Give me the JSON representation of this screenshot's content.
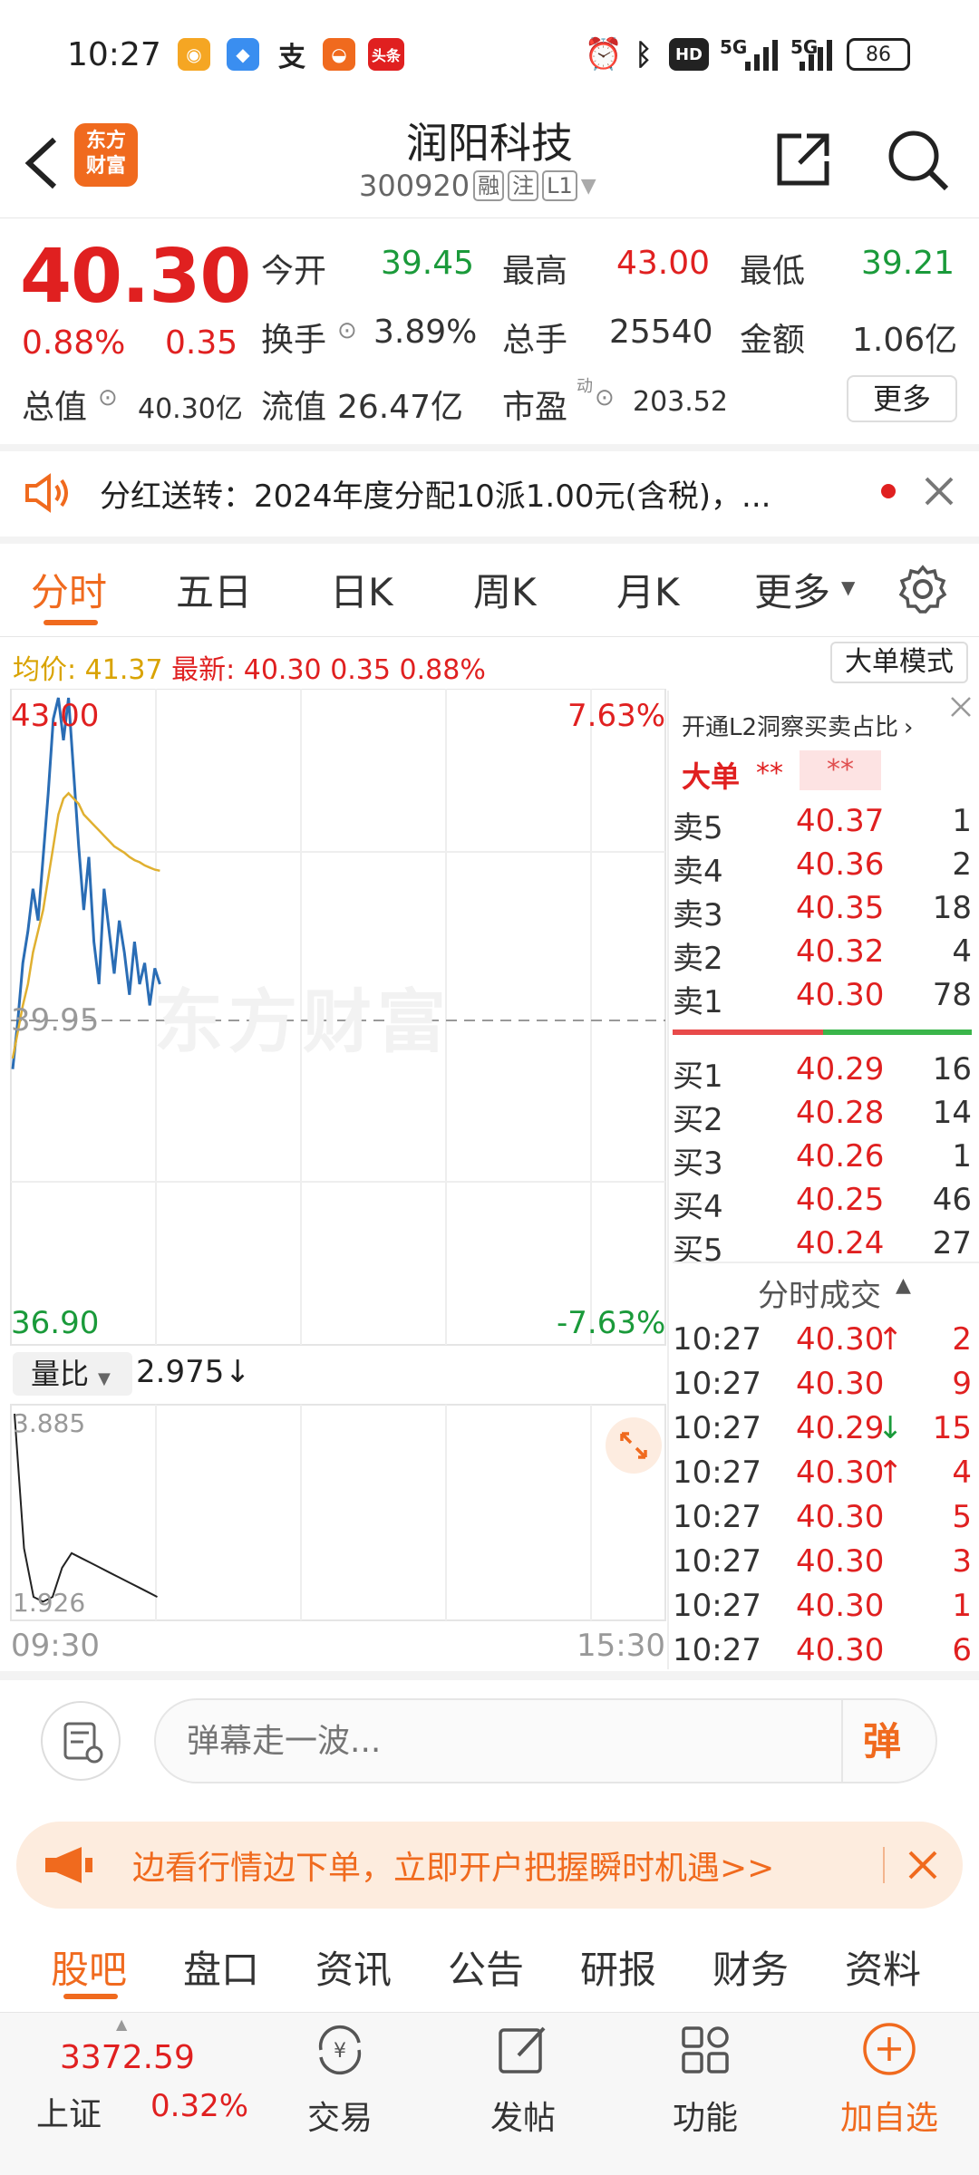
{
  "status_bar": {
    "time": "10:27",
    "battery": "86",
    "network_a": "5G",
    "network_b": "5G",
    "hd": "HD",
    "app_icon_toutiao": "头条"
  },
  "header": {
    "logo_line1": "东方",
    "logo_line2": "财富",
    "title": "润阳科技",
    "code": "300920",
    "tag_rong": "融",
    "tag_zhu": "注",
    "tag_l1": "L1"
  },
  "quote": {
    "price": "40.30",
    "change_pct": "0.88%",
    "change": "0.35",
    "open_label": "今开",
    "open": "39.45",
    "high_label": "最高",
    "high": "43.00",
    "low_label": "最低",
    "low": "39.21",
    "turnover_label": "换手",
    "turnover": "3.89%",
    "volume_label": "总手",
    "volume": "25540",
    "amount_label": "金额",
    "amount": "1.06亿",
    "mcap_label": "总值",
    "mcap": "40.30亿",
    "float_label": "流值",
    "float": "26.47亿",
    "pe_label": "市盈",
    "pe_sup": "动",
    "pe": "203.52",
    "more": "更多"
  },
  "dividend": {
    "text": "分红送转：2024年度分配10派1.00元(含税)，..."
  },
  "chart_tabs": [
    "分时",
    "五日",
    "日K",
    "周K",
    "月K",
    "更多"
  ],
  "chart_info": {
    "avg_label": "均价:",
    "avg": "41.37",
    "last_label": "最新:",
    "last": "40.30",
    "chg": "0.35",
    "pct": "0.88%",
    "mode": "大单模式"
  },
  "chart_labels": {
    "top_price": "43.00",
    "top_pct": "7.63%",
    "mid_price": "39.95",
    "bot_price": "36.90",
    "bot_pct": "-7.63%",
    "watermark": "东方财富",
    "time_start": "09:30",
    "time_end": "15:30"
  },
  "volume_ratio": {
    "label": "量比",
    "value": "2.975",
    "top": "3.885",
    "bottom": "1.926"
  },
  "chart_data": {
    "type": "line",
    "series": [
      {
        "name": "",
        "color": "#2a6db5",
        "values": [
          39.5,
          39.95,
          40.5,
          40.8,
          41.2,
          40.9,
          41.5,
          42.1,
          42.8,
          43.0,
          42.6,
          43.0,
          42.3,
          41.6,
          41.0,
          41.5,
          40.7,
          40.3,
          41.2,
          40.8,
          40.4,
          40.9,
          40.6,
          40.2,
          40.7,
          40.3,
          40.5,
          40.1,
          40.45,
          40.3
        ]
      },
      {
        "name": "",
        "color": "#e0b030",
        "values": [
          39.6,
          39.85,
          40.1,
          40.3,
          40.6,
          40.8,
          41.0,
          41.3,
          41.6,
          41.9,
          42.05,
          42.1,
          42.05,
          42.0,
          41.9,
          41.85,
          41.8,
          41.75,
          41.7,
          41.65,
          41.6,
          41.57,
          41.54,
          41.5,
          41.47,
          41.45,
          41.42,
          41.4,
          41.38,
          41.37
        ]
      }
    ],
    "ylim": [
      36.9,
      43.0
    ]
  },
  "volume_ratio_data": {
    "values": [
      3.885,
      2.5,
      2.0,
      1.95,
      2.0,
      2.3,
      2.45,
      2.4,
      2.35,
      2.3,
      2.25,
      2.2,
      2.15,
      2.1,
      2.05,
      2.0
    ],
    "ylim": [
      1.926,
      3.885
    ]
  },
  "orderbook": {
    "title": "开通L2洞察买卖占比",
    "big_label": "大单",
    "big_a": "**",
    "big_b": "**",
    "sells": [
      {
        "label": "卖5",
        "price": "40.37",
        "vol": "1"
      },
      {
        "label": "卖4",
        "price": "40.36",
        "vol": "2"
      },
      {
        "label": "卖3",
        "price": "40.35",
        "vol": "18"
      },
      {
        "label": "卖2",
        "price": "40.32",
        "vol": "4"
      },
      {
        "label": "卖1",
        "price": "40.30",
        "vol": "78"
      }
    ],
    "buys": [
      {
        "label": "买1",
        "price": "40.29",
        "vol": "16"
      },
      {
        "label": "买2",
        "price": "40.28",
        "vol": "14"
      },
      {
        "label": "买3",
        "price": "40.26",
        "vol": "1"
      },
      {
        "label": "买4",
        "price": "40.25",
        "vol": "46"
      },
      {
        "label": "买5",
        "price": "40.24",
        "vol": "27"
      }
    ],
    "ticks_title": "分时成交",
    "ticks": [
      {
        "time": "10:27",
        "price": "40.30",
        "dir": "↑",
        "vol": "2"
      },
      {
        "time": "10:27",
        "price": "40.30",
        "dir": "",
        "vol": "9"
      },
      {
        "time": "10:27",
        "price": "40.29",
        "dir": "↓",
        "vol": "15"
      },
      {
        "time": "10:27",
        "price": "40.30",
        "dir": "↑",
        "vol": "4"
      },
      {
        "time": "10:27",
        "price": "40.30",
        "dir": "",
        "vol": "5"
      },
      {
        "time": "10:27",
        "price": "40.30",
        "dir": "",
        "vol": "3"
      },
      {
        "time": "10:27",
        "price": "40.30",
        "dir": "",
        "vol": "1"
      },
      {
        "time": "10:27",
        "price": "40.30",
        "dir": "",
        "vol": "6"
      }
    ]
  },
  "comment": {
    "placeholder": "弹幕走一波...",
    "danmu": "弹"
  },
  "promo": {
    "text": "边看行情边下单，立即开户把握瞬时机遇>>"
  },
  "footer_tabs": [
    "股吧",
    "盘口",
    "资讯",
    "公告",
    "研报",
    "财务",
    "资料"
  ],
  "bottom_nav": {
    "index_value": "3372.59",
    "index_name": "上证",
    "index_pct": "0.32%",
    "trade": "交易",
    "post": "发帖",
    "func": "功能",
    "add": "加自选"
  }
}
